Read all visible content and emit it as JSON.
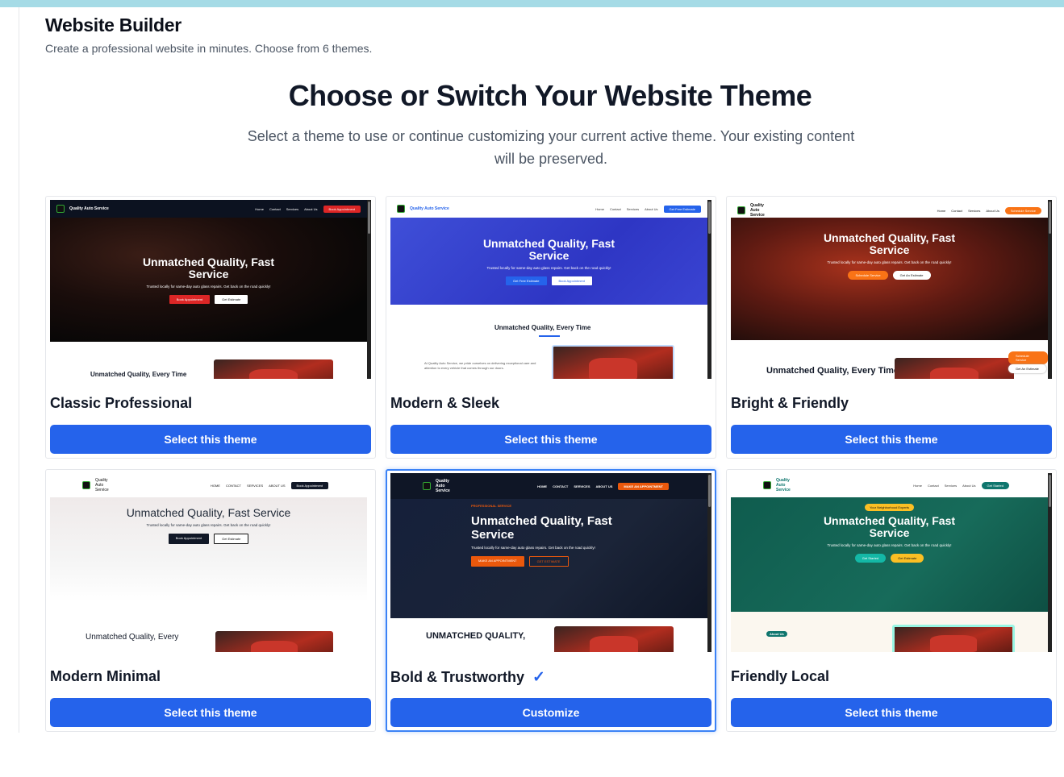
{
  "header": {
    "title": "Website Builder",
    "subtitle": "Create a professional website in minutes. Choose from 6 themes."
  },
  "main": {
    "heading": "Choose or Switch Your Website Theme",
    "description": "Select a theme to use or continue customizing your current active theme. Your existing content will be preserved."
  },
  "colors": {
    "primary": "#2563eb",
    "active_border": "#3b82f6",
    "top_strip": "#a5dbe6"
  },
  "themes": [
    {
      "name": "Classic Professional",
      "button": "Select this theme",
      "active": false,
      "preview": {
        "brand": "Quality Auto Service",
        "links": [
          "Home",
          "Contact",
          "Services",
          "About Us"
        ],
        "cta": "Book Appointment",
        "hero_title": "Unmatched Quality, Fast Service",
        "hero_sub": "Trusted locally for same-day auto glass repairs. Get back on the road quickly!",
        "btn1": "Book Appointment",
        "btn2": "Get Estimate",
        "section_title": "Unmatched Quality, Every Time"
      }
    },
    {
      "name": "Modern & Sleek",
      "button": "Select this theme",
      "active": false,
      "preview": {
        "brand": "Quality Auto Service",
        "links": [
          "Home",
          "Contact",
          "Services",
          "About Us"
        ],
        "cta": "Get Free Estimate",
        "hero_title": "Unmatched Quality, Fast Service",
        "hero_sub": "Trusted locally for same-day auto glass repairs. Get back on the road quickly!",
        "btn1": "Get Free Estimate",
        "btn2": "Book Appointment",
        "section_title": "Unmatched Quality, Every Time",
        "section_text": "At Quality Auto Service, we pride ourselves on delivering exceptional care and attention to every vehicle that comes through our doors."
      }
    },
    {
      "name": "Bright & Friendly",
      "button": "Select this theme",
      "active": false,
      "preview": {
        "brand": "Quality Auto Service",
        "links": [
          "Home",
          "Contact",
          "Services",
          "About Us"
        ],
        "cta": "Schedule Service",
        "hero_title": "Unmatched Quality, Fast Service",
        "hero_sub": "Trusted locally for same-day auto glass repairs. Get back on the road quickly!",
        "btn1": "Schedule Service",
        "btn2": "Get An Estimate",
        "section_title": "Unmatched Quality, Every Time"
      }
    },
    {
      "name": "Modern Minimal",
      "button": "Select this theme",
      "active": false,
      "preview": {
        "brand": "Quality Auto Service",
        "links": [
          "HOME",
          "CONTACT",
          "SERVICES",
          "ABOUT US"
        ],
        "cta": "Book Appointment",
        "hero_title": "Unmatched Quality, Fast Service",
        "hero_sub": "Trusted locally for same-day auto glass repairs. Get back on the road quickly!",
        "btn1": "Book Appointment",
        "btn2": "Get Estimate",
        "section_title": "Unmatched Quality, Every"
      }
    },
    {
      "name": "Bold & Trustworthy",
      "button": "Customize",
      "active": true,
      "preview": {
        "brand": "Quality Auto Service",
        "links": [
          "HOME",
          "CONTACT",
          "SERVICES",
          "ABOUT US"
        ],
        "cta": "MAKE AN APPOINTMENT",
        "tagline": "PROFESSIONAL SERVICE",
        "hero_title": "Unmatched Quality, Fast Service",
        "hero_sub": "Trusted locally for same-day auto glass repairs. Get back on the road quickly!",
        "btn1": "MAKE AN APPOINTMENT",
        "btn2": "GET ESTIMATE",
        "section_title": "UNMATCHED QUALITY,"
      }
    },
    {
      "name": "Friendly Local",
      "button": "Select this theme",
      "active": false,
      "preview": {
        "brand": "Quality Auto Service",
        "links": [
          "Home",
          "Contact",
          "Services",
          "About Us"
        ],
        "cta": "Get Started",
        "badge": "Your Neighborhood Experts",
        "hero_title": "Unmatched Quality, Fast Service",
        "hero_sub": "Trusted locally for same-day auto glass repairs. Get back on the road quickly!",
        "btn1": "Get Started",
        "btn2": "Get Estimate",
        "section_tag": "About Us"
      }
    }
  ]
}
